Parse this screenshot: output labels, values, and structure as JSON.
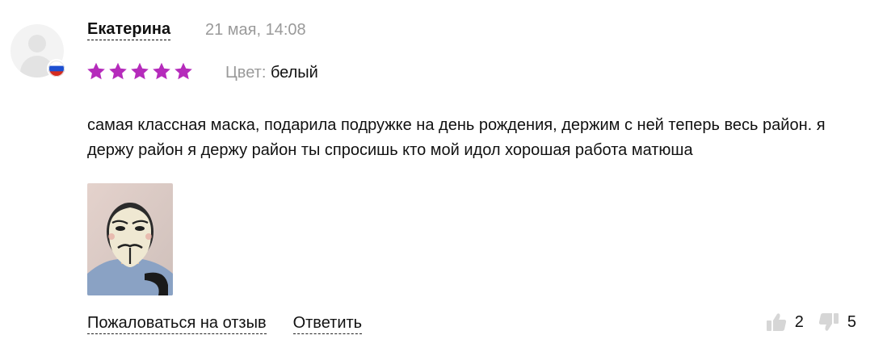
{
  "review": {
    "author": "Екатерина",
    "date": "21 мая, 14:08",
    "rating": 5,
    "rating_max": 5,
    "star_color": "#b52bbb",
    "attribute": {
      "key": "Цвет:",
      "value": "белый"
    },
    "text": "самая классная маска, подарила подружке на день рождения, держим с ней теперь весь район. я держу район я держу район ты спросишь кто мой идол хорошая работа матюша",
    "country_flag_icon": "russia-flag-icon",
    "photo_icon": "review-photo"
  },
  "actions": {
    "complain_label": "Пожаловаться на отзыв",
    "reply_label": "Ответить"
  },
  "votes": {
    "likes": "2",
    "dislikes": "5"
  }
}
